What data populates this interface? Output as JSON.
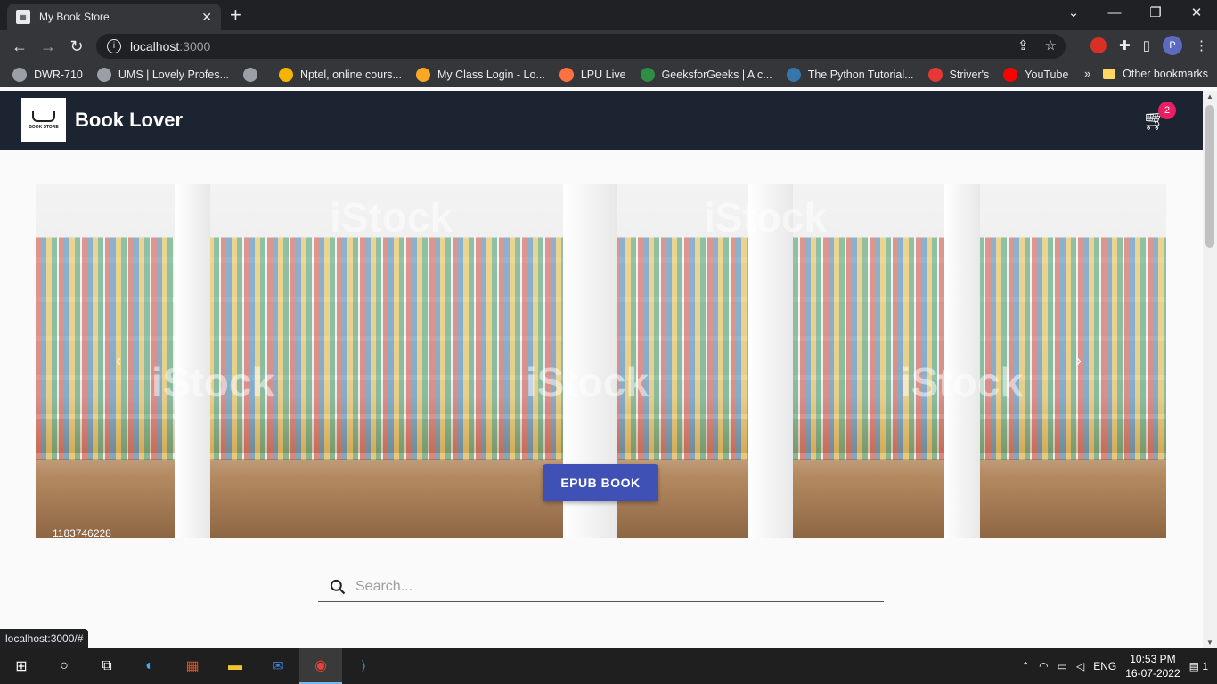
{
  "browser": {
    "tab_title": "My Book Store",
    "url_host": "localhost",
    "url_port": ":3000",
    "bookmarks": [
      {
        "label": "DWR-710",
        "color": "#9aa0a6"
      },
      {
        "label": "UMS | Lovely Profes...",
        "color": "#9aa0a6"
      },
      {
        "label": "",
        "color": "#9aa0a6"
      },
      {
        "label": "Nptel, online cours...",
        "color": "#f4b400"
      },
      {
        "label": "My Class Login - Lo...",
        "color": "#f9a825"
      },
      {
        "label": "LPU Live",
        "color": "#ff7043"
      },
      {
        "label": "GeeksforGeeks | A c...",
        "color": "#2f8d46"
      },
      {
        "label": "The Python Tutorial...",
        "color": "#3776ab"
      },
      {
        "label": "Striver's",
        "color": "#e53935"
      },
      {
        "label": "YouTube",
        "color": "#ff0000"
      }
    ],
    "other_bookmarks": "Other bookmarks",
    "profile_initial": "P",
    "status_url": "localhost:3000/#"
  },
  "app": {
    "brand": "Book Lover",
    "logo_text": "BOOK STORE",
    "cart_count": "2",
    "hero": {
      "cta_label": "EPUB BOOK",
      "stock_id": "1183746228",
      "watermark": "iStock"
    },
    "search": {
      "placeholder": "Search...",
      "value": ""
    }
  },
  "taskbar": {
    "lang": "ENG",
    "time": "10:53 PM",
    "date": "16-07-2022",
    "notifications": "1"
  }
}
